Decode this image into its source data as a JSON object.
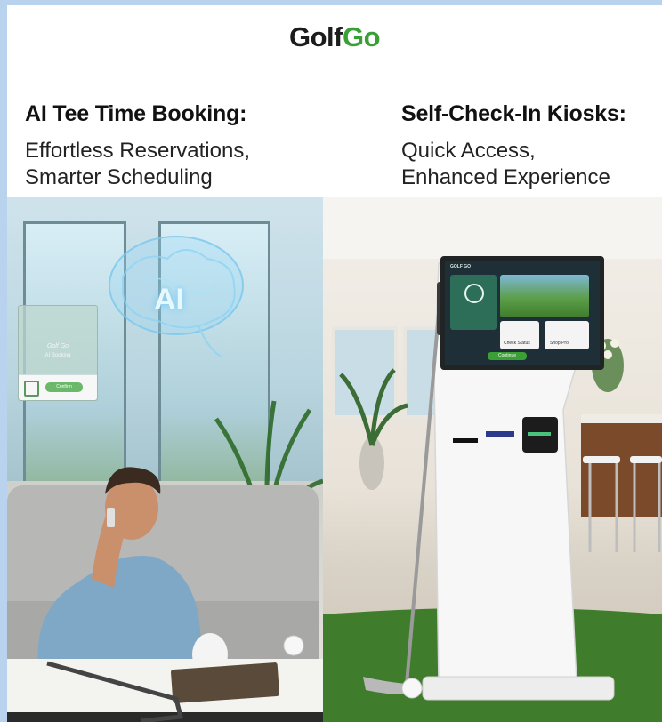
{
  "brand": {
    "word1": "Golf",
    "word2": "Go"
  },
  "left_feature": {
    "title": "AI Tee Time Booking:",
    "subtitle_lines": [
      "Effortless Reservations,",
      "Smarter Scheduling"
    ]
  },
  "right_feature": {
    "title": "Self-Check-In Kiosks:",
    "subtitle_lines": [
      "Quick Access,",
      "Enhanced Experience"
    ]
  },
  "ai_hologram": {
    "label": "AI"
  },
  "ai_card": {
    "title": "Golf Go",
    "subtitle": "AI Booking",
    "button": "Confirm"
  },
  "kiosk": {
    "brand": "GOLF GO",
    "tile1": "Check Status",
    "tile2": "Shop Pro",
    "button": "Continue"
  },
  "colors": {
    "brand_green": "#3aa035",
    "frame_background": "#b9d3ee"
  }
}
